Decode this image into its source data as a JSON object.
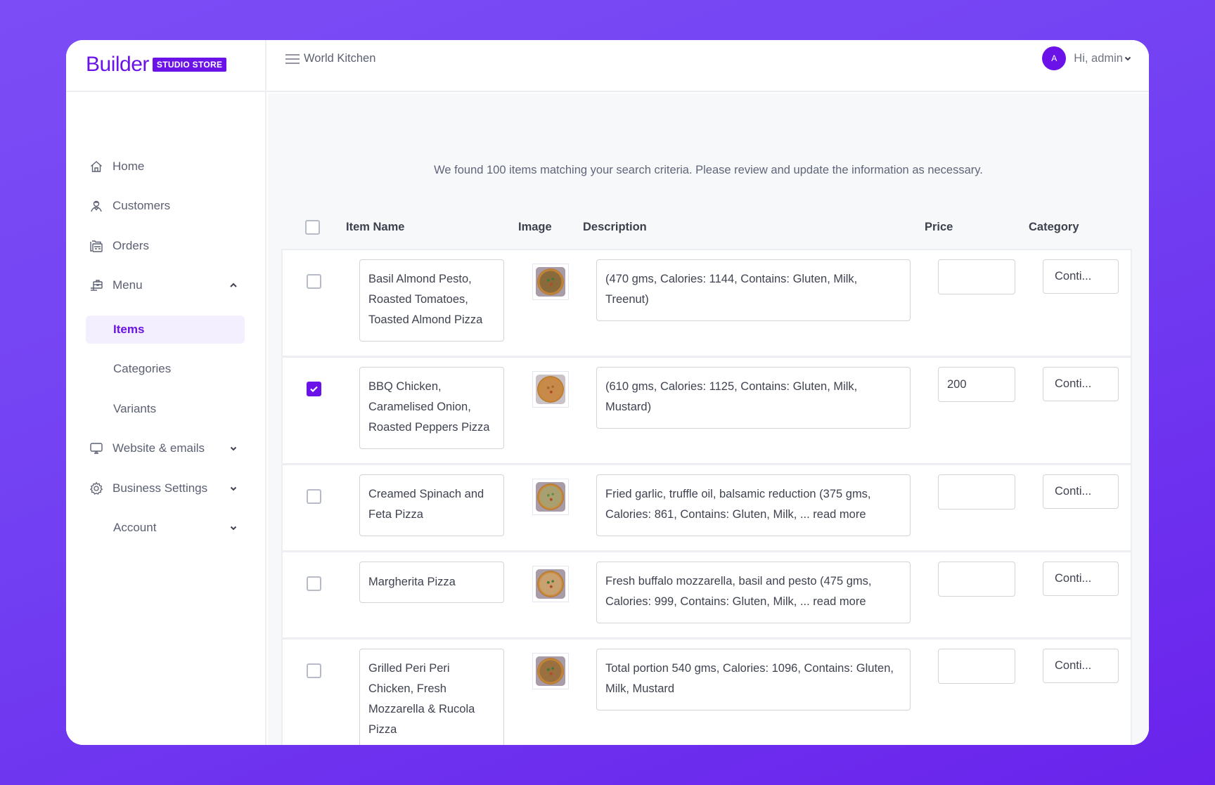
{
  "brand": {
    "logo_word": "Builder",
    "logo_badge": "STUDIO STORE",
    "accent_color": "#6b12e8"
  },
  "header": {
    "menu_icon": "hamburger-icon",
    "store_name": "World Kitchen",
    "avatar_initial": "A",
    "greeting": "Hi, admin"
  },
  "sidebar": {
    "items": [
      {
        "label": "Home",
        "icon": "home-icon"
      },
      {
        "label": "Customers",
        "icon": "user-icon"
      },
      {
        "label": "Orders",
        "icon": "orders-icon"
      },
      {
        "label": "Menu",
        "icon": "menu-board-icon",
        "expanded": true
      },
      {
        "label": "Items",
        "sub": true,
        "active": true
      },
      {
        "label": "Categories",
        "sub": true
      },
      {
        "label": "Variants",
        "sub": true
      },
      {
        "label": "Website & emails",
        "icon": "monitor-icon",
        "expanded": false
      },
      {
        "label": "Business Settings",
        "icon": "gear-icon",
        "expanded": false
      },
      {
        "label": "Account",
        "expanded": false
      }
    ]
  },
  "main": {
    "message": "We found 100 items matching your search criteria. Please review and update the information as necessary.",
    "table": {
      "columns": [
        "Item Name",
        "Image",
        "Description",
        "Price",
        "Category"
      ],
      "rows": [
        {
          "checked": false,
          "name": "Basil Almond Pesto, Roasted Tomatoes, Toasted Almond Pizza",
          "image": "pizza-thumbnail",
          "description": "(470 gms, Calories: 1144, Contains: Gluten, Milk, Treenut)",
          "price": "",
          "category": "Conti..."
        },
        {
          "checked": true,
          "name": "BBQ Chicken, Caramelised Onion, Roasted Peppers Pizza",
          "image": "pizza-thumbnail",
          "description": "(610 gms, Calories: 1125, Contains: Gluten, Milk, Mustard)",
          "price": "200",
          "category": "Conti..."
        },
        {
          "checked": false,
          "name": "Creamed Spinach and Feta Pizza",
          "image": "pizza-thumbnail",
          "description": "Fried garlic, truffle oil, balsamic reduction (375 gms, Calories: 861, Contains: Gluten, Milk, ... read more",
          "price": "",
          "category": "Conti..."
        },
        {
          "checked": false,
          "name": "Margherita Pizza",
          "image": "pizza-thumbnail",
          "description": "Fresh buffalo mozzarella, basil and pesto (475 gms, Calories: 999, Contains: Gluten, Milk, ... read more",
          "price": "",
          "category": "Conti..."
        },
        {
          "checked": false,
          "name": "Grilled Peri Peri Chicken, Fresh Mozzarella & Rucola Pizza",
          "image": "pizza-thumbnail",
          "description": "Total portion 540 gms, Calories: 1096, Contains: Gluten, Milk, Mustard",
          "price": "",
          "category": "Conti..."
        }
      ]
    }
  }
}
